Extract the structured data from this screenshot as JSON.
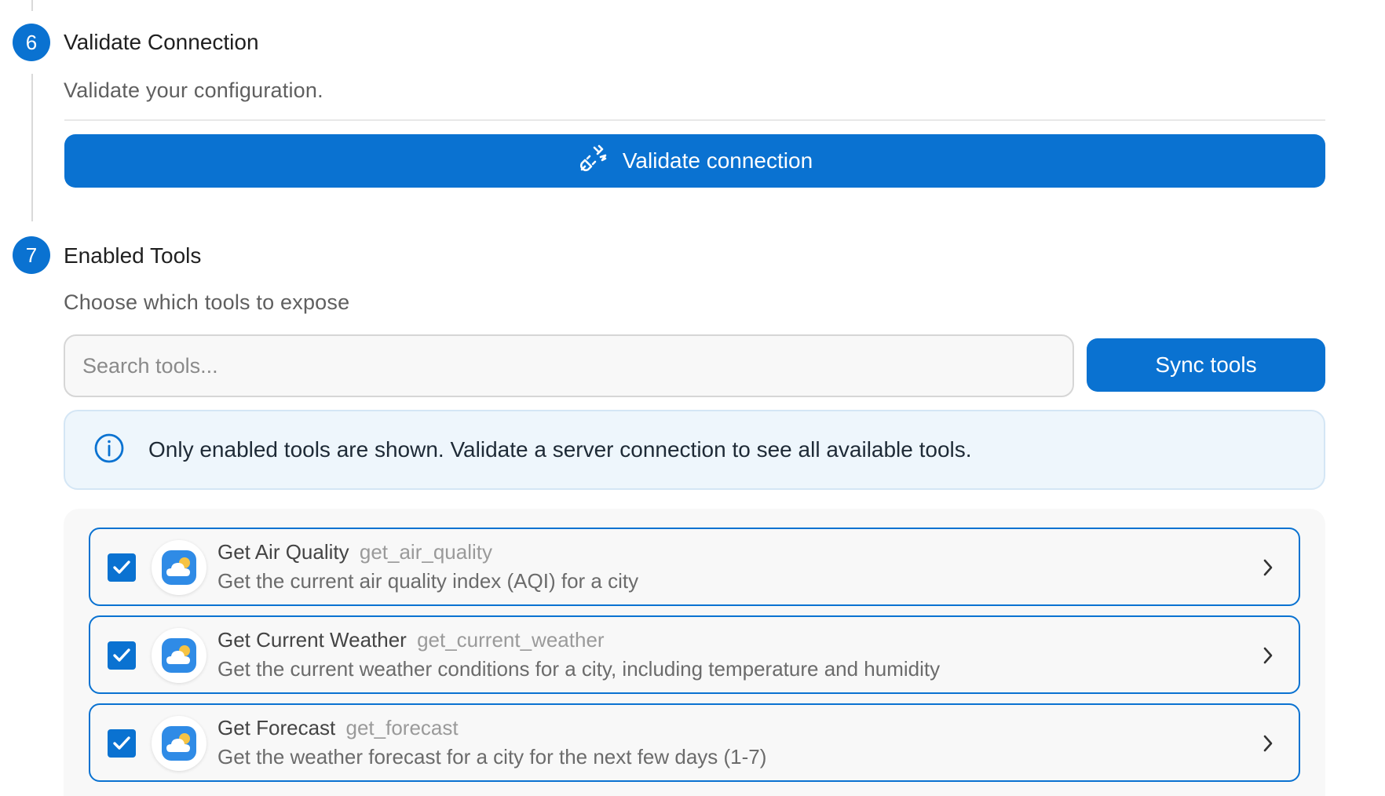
{
  "steps": {
    "validate": {
      "number": "6",
      "title": "Validate Connection",
      "subtitle": "Validate your configuration.",
      "button_label": "Validate connection",
      "button_icon": "plug-icon"
    },
    "tools": {
      "number": "7",
      "title": "Enabled Tools",
      "subtitle": "Choose which tools to expose",
      "search_placeholder": "Search tools...",
      "sync_label": "Sync tools",
      "info_icon": "info-icon",
      "info_text": "Only enabled tools are shown. Validate a server connection to see all available tools.",
      "items": [
        {
          "name": "Get Air Quality",
          "slug": "get_air_quality",
          "description": "Get the current air quality index (AQI) for a city",
          "checked": true,
          "icon": "weather-icon"
        },
        {
          "name": "Get Current Weather",
          "slug": "get_current_weather",
          "description": "Get the current weather conditions for a city, including temperature and humidity",
          "checked": true,
          "icon": "weather-icon"
        },
        {
          "name": "Get Forecast",
          "slug": "get_forecast",
          "description": "Get the weather forecast for a city for the next few days (1-7)",
          "checked": true,
          "icon": "weather-icon"
        }
      ]
    }
  },
  "colors": {
    "accent": "#0a72d1",
    "info_bg": "#eef6fc",
    "info_border": "#d4e6f5",
    "connector_line": "#d9d9d9"
  }
}
